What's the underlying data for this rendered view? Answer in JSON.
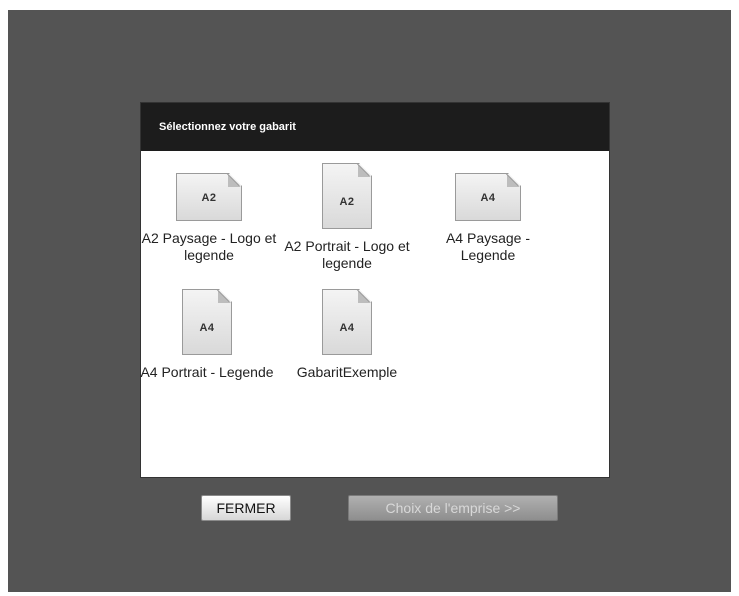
{
  "dialog": {
    "title": "Sélectionnez votre gabarit"
  },
  "templates": [
    {
      "format": "A2",
      "orientation": "landscape",
      "name": "A2 Paysage - Logo et legende"
    },
    {
      "format": "A2",
      "orientation": "portrait",
      "name": "A2 Portrait - Logo et legende"
    },
    {
      "format": "A4",
      "orientation": "landscape",
      "name": "A4 Paysage - Legende"
    },
    {
      "format": "A4",
      "orientation": "portrait",
      "name": "A4 Portrait - Legende"
    },
    {
      "format": "A4",
      "orientation": "portrait",
      "name": "GabaritExemple"
    }
  ],
  "buttons": {
    "close_label": "FERMER",
    "next_label": "Choix de l'emprise >>",
    "next_enabled": false
  },
  "icons": {
    "template": "document-icon"
  },
  "colors": {
    "overlay": "#545454",
    "header": "#1c1c1c"
  }
}
